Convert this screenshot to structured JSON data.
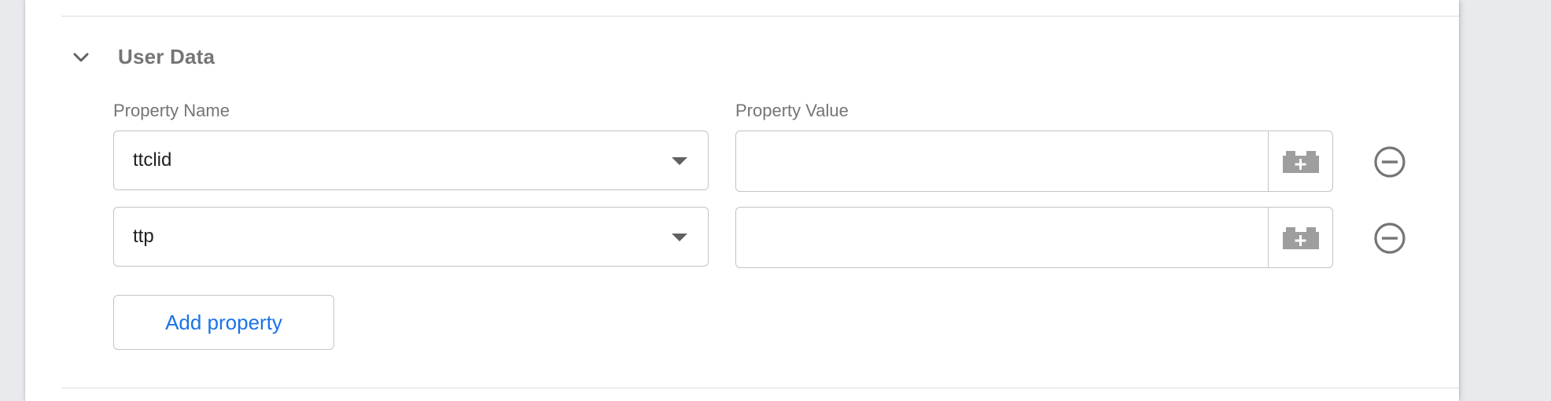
{
  "section": {
    "title": "User Data",
    "toggle_icon": "chevron-down-icon"
  },
  "columns": {
    "name_label": "Property Name",
    "value_label": "Property Value"
  },
  "rows": [
    {
      "name": "ttclid",
      "value": ""
    },
    {
      "name": "ttp",
      "value": ""
    }
  ],
  "icons": {
    "dropdown": "dropdown-arrow-icon",
    "variable": "variable-picker-icon",
    "remove": "remove-circle-icon"
  },
  "actions": {
    "add_property_label": "Add property"
  },
  "colors": {
    "accent": "#1a73e8",
    "label_gray": "#757575",
    "icon_gray": "#757575",
    "border": "#c4c4c4",
    "background": "#e8eaed"
  }
}
